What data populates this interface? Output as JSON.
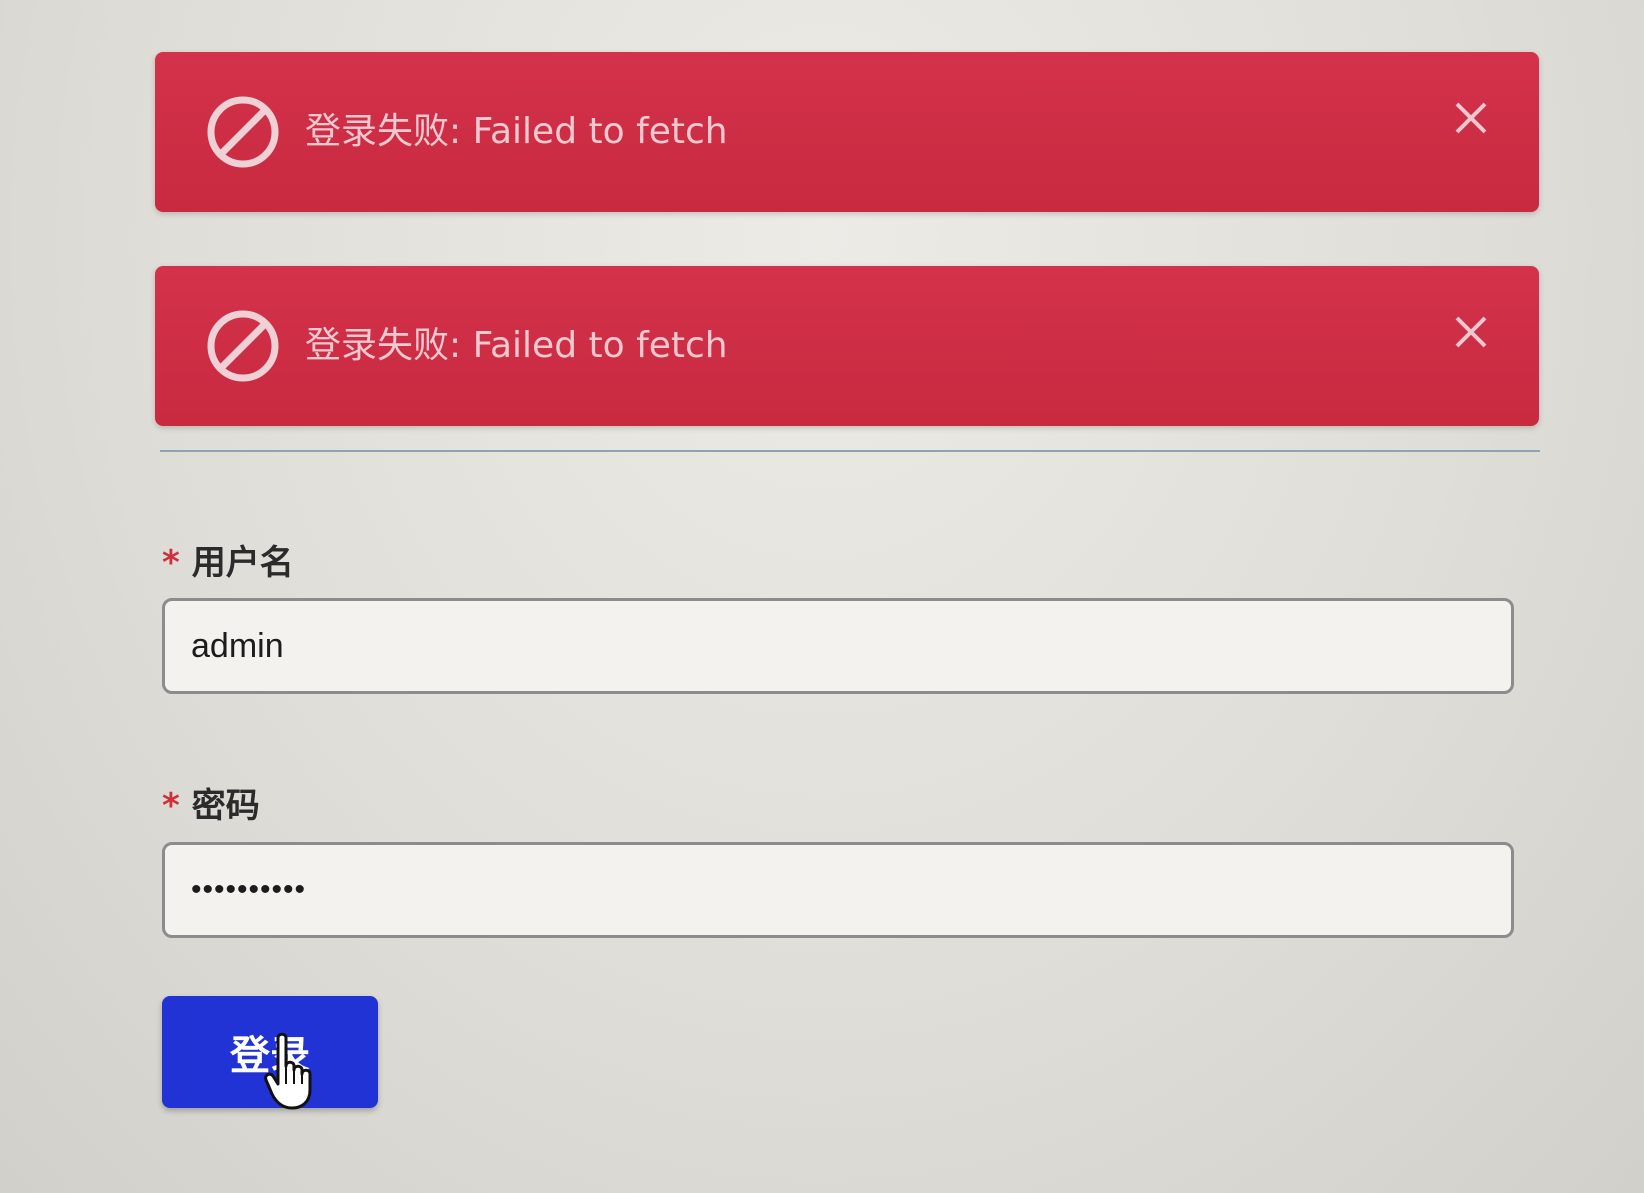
{
  "alerts": [
    {
      "message": "登录失败: Failed to fetch",
      "icon": "forbidden-icon",
      "close_icon": "close-icon"
    },
    {
      "message": "登录失败: Failed to fetch",
      "icon": "forbidden-icon",
      "close_icon": "close-icon"
    }
  ],
  "form": {
    "username": {
      "required_mark": "*",
      "label": "用户名",
      "value": "admin"
    },
    "password": {
      "required_mark": "*",
      "label": "密码",
      "value": "••••••••••"
    },
    "submit_label": "登录"
  },
  "colors": {
    "alert_bg": "#d3324a",
    "button_bg": "#2233d6",
    "required": "#d0303a"
  }
}
